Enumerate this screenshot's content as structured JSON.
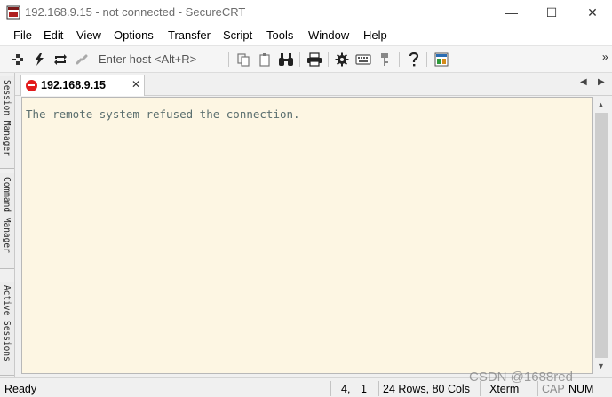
{
  "window": {
    "title": "192.168.9.15 - not connected - SecureCRT",
    "minimize": "—",
    "maximize": "☐",
    "close": "✕"
  },
  "menu": [
    "File",
    "Edit",
    "View",
    "Options",
    "Transfer",
    "Script",
    "Tools",
    "Window",
    "Help"
  ],
  "toolbar": {
    "host_placeholder": "Enter host <Alt+R>",
    "overflow": "»",
    "icons": [
      "connect-in-tab-icon",
      "lightning-icon",
      "reconnect-icon",
      "disconnect-icon",
      "copy-icon",
      "paste-icon",
      "find-icon",
      "print-icon",
      "settings-icon",
      "keymap-icon",
      "key-icon",
      "help-icon",
      "sessions-image-icon"
    ]
  },
  "side_tabs": [
    "Session Manager",
    "Command Manager",
    "Active Sessions"
  ],
  "tab": {
    "label": "192.168.9.15",
    "close": "✕",
    "status_color": "#e21b1b"
  },
  "tab_nav": {
    "prev": "◀",
    "next": "▶"
  },
  "terminal": {
    "line1": "The remote system refused the connection.",
    "background": "#fdf6e3",
    "text_color": "#5a6e6e"
  },
  "statusbar": {
    "ready": "Ready",
    "row": "4,",
    "col": "1",
    "size": "24 Rows, 80 Cols",
    "emulation": "Xterm",
    "cap": "CAP",
    "num": "NUM"
  },
  "watermark": "CSDN @1688red"
}
